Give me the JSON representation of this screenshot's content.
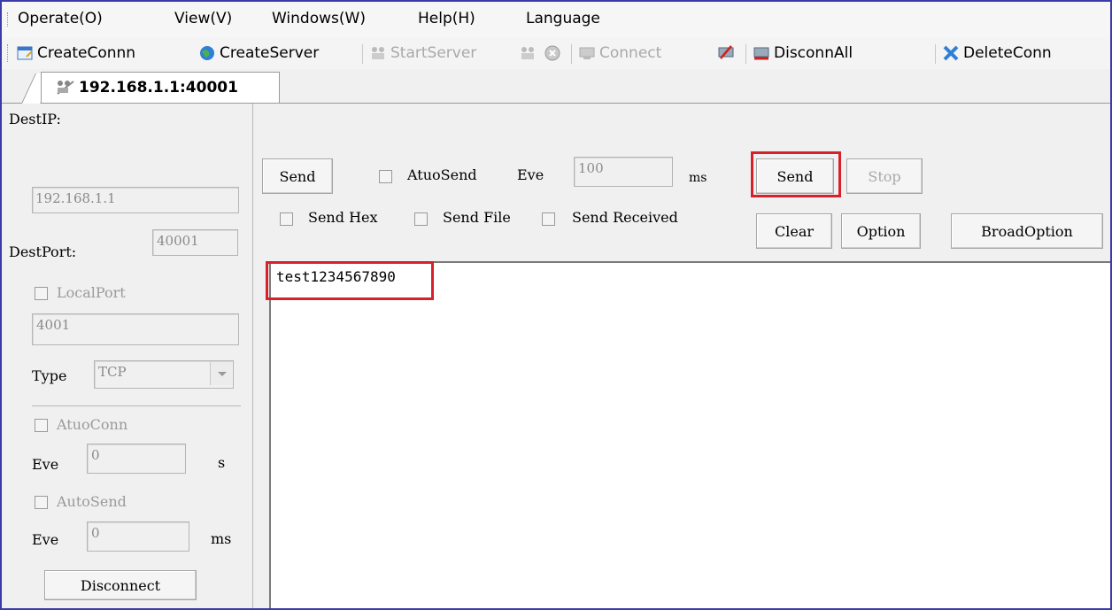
{
  "menu": {
    "items": [
      "Operate(O)",
      "View(V)",
      "Windows(W)",
      "Help(H)",
      "Language"
    ]
  },
  "toolbar": {
    "create_conn": "CreateConnn",
    "create_server": "CreateServer",
    "start_server": "StartServer",
    "connect": "Connect",
    "disconn_all": "DisconnAll",
    "delete_conn": "DeleteConn"
  },
  "tab": {
    "label": "192.168.1.1:40001"
  },
  "left": {
    "dest_ip_label": "DestIP:",
    "dest_ip_value": "192.168.1.1",
    "dest_port_label": "DestPort:",
    "dest_port_value": "40001",
    "local_port_label": "LocalPort",
    "local_port_value": "4001",
    "type_label": "Type",
    "type_value": "TCP",
    "auto_conn_label": "AtuoConn",
    "eve1_label": "Eve",
    "eve1_value": "0",
    "eve1_unit": "s",
    "auto_send_label": "AutoSend",
    "eve2_label": "Eve",
    "eve2_value": "0",
    "eve2_unit": "ms",
    "disconnect": "Disconnect"
  },
  "right": {
    "send_mode": "Send",
    "atuo_send_label": "AtuoSend",
    "eve_label": "Eve",
    "eve_value": "100",
    "eve_unit": "ms",
    "send_button": "Send",
    "stop_button": "Stop",
    "send_hex": "Send Hex",
    "send_file": "Send File",
    "send_received": "Send Received",
    "clear_button": "Clear",
    "option_button": "Option",
    "broad_option_button": "BroadOption",
    "payload": "test1234567890"
  },
  "colors": {
    "highlight": "#d8202a",
    "frame": "#3a3aa8"
  }
}
